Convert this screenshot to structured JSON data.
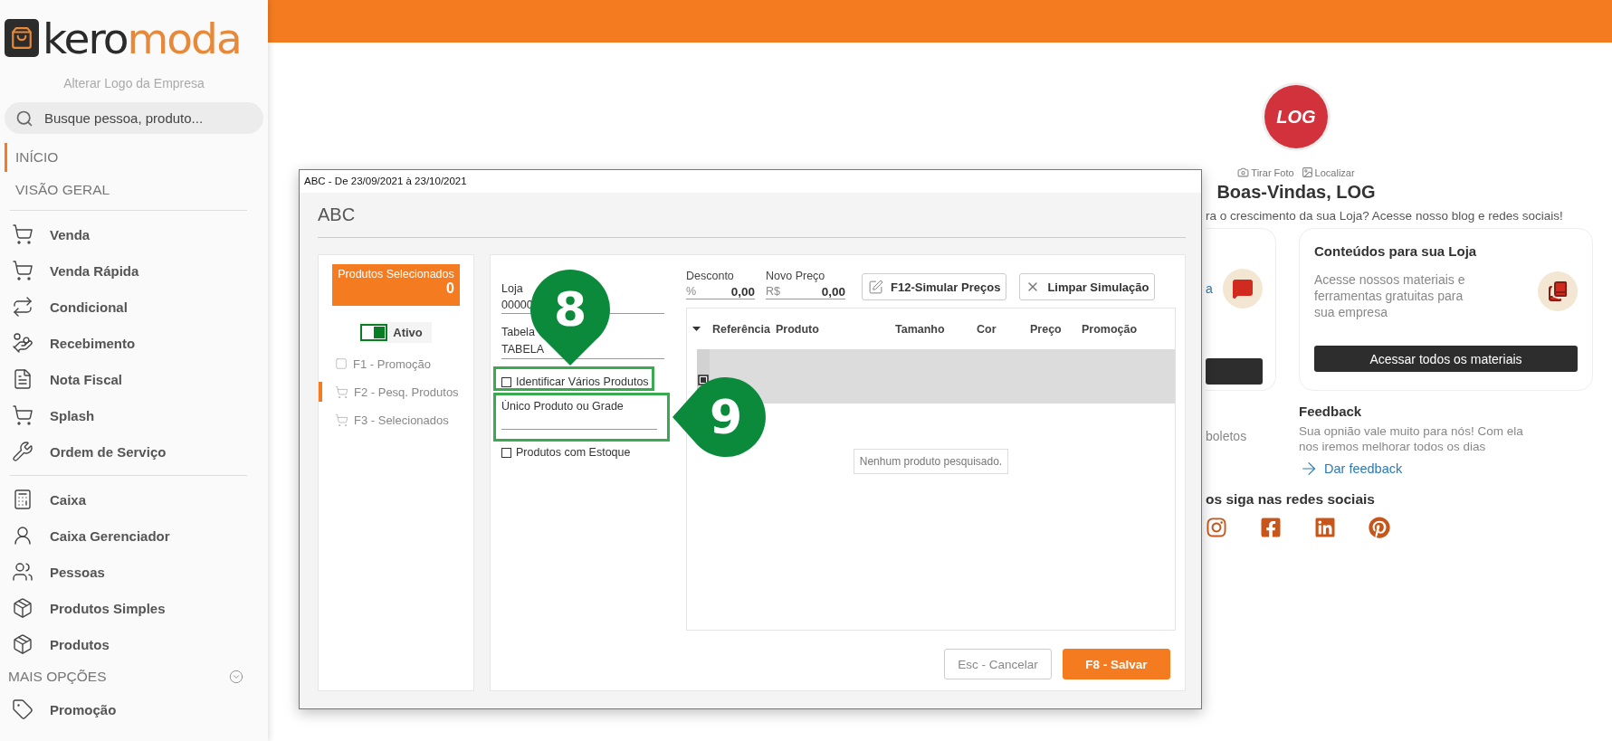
{
  "sidebar": {
    "logo": {
      "wordmark_dark": "kero",
      "wordmark_accent": "moda"
    },
    "change_logo_link": "Alterar Logo da Empresa",
    "search": {
      "placeholder": "Busque pessoa, produto..."
    },
    "nav": [
      {
        "label": "INÍCIO",
        "selected": true
      },
      {
        "label": "VISÃO GERAL",
        "selected": false
      }
    ],
    "groups": [
      [
        {
          "label": "Venda"
        },
        {
          "label": "Venda Rápida"
        },
        {
          "label": "Condicional"
        },
        {
          "label": "Recebimento"
        },
        {
          "label": "Nota Fiscal"
        },
        {
          "label": "Splash"
        },
        {
          "label": "Ordem de Serviço"
        }
      ],
      [
        {
          "label": "Caixa"
        },
        {
          "label": "Caixa Gerenciador"
        },
        {
          "label": "Pessoas"
        },
        {
          "label": "Produtos Simples"
        },
        {
          "label": "Produtos"
        }
      ]
    ],
    "more": {
      "label": "MAIS OPÇÕES",
      "items": [
        {
          "label": "Promoção"
        }
      ]
    }
  },
  "home": {
    "logo_text": "LOG",
    "photo_actions": [
      "Tirar Foto",
      "Localizar"
    ],
    "welcome": "Boas-Vindas, LOG",
    "subtitle": "ra o crescimento da sua Loja? Acesse nosso blog e redes sociais!",
    "left_card": {
      "link": "a"
    },
    "right_card": {
      "title": "Conteúdos para sua Loja",
      "text": "Acesse nossos materiais e ferramentas gratuitas para sua empresa",
      "button": "Acessar todos os materiais"
    },
    "left_fragment": "boletos",
    "feedback": {
      "title": "Feedback",
      "text": "Sua opnião vale muito para nós! Com ela nos iremos melhorar todos os dias",
      "link": "Dar feedback"
    },
    "social": {
      "title": "os siga nas redes sociais"
    }
  },
  "dialog": {
    "window_title": "ABC - De 23/09/2021 à 23/10/2021",
    "heading": "ABC",
    "selected_box": {
      "label": "Produtos Selecionados",
      "count": "0"
    },
    "toggle": {
      "label": "Ativo",
      "on": true
    },
    "nav": [
      {
        "label": "F1 - Promoção",
        "selected": false
      },
      {
        "label": "F2 - Pesq. Produtos",
        "selected": true
      },
      {
        "label": "F3 - Selecionados",
        "selected": false
      }
    ],
    "form": {
      "store": {
        "label": "Loja",
        "value": "00000"
      },
      "table": {
        "label": "Tabela",
        "value": "TABELA"
      },
      "identify_many": {
        "label": "Identificar Vários Produtos",
        "checked": false
      },
      "product_field": {
        "placeholder": "Único Produto ou Grade"
      },
      "with_stock": {
        "label": "Produtos com Estoque",
        "checked": false
      }
    },
    "discount": {
      "label": "Desconto",
      "unit": "%",
      "value": "0,00"
    },
    "new_price": {
      "label": "Novo Preço",
      "unit": "R$",
      "value": "0,00"
    },
    "buttons": [
      "F12-Simular Preços",
      "Limpar Simulação"
    ],
    "grid": {
      "columns": [
        "Referência",
        "Produto",
        "Tamanho",
        "Cor",
        "Preço",
        "Promoção"
      ],
      "empty_message": "Nenhum produto pesquisado."
    },
    "footer": [
      {
        "label": "Esc - Cancelar",
        "kind": "secondary"
      },
      {
        "label": "F8 - Salvar",
        "kind": "primary"
      }
    ],
    "callouts": [
      {
        "label": "8",
        "kind": "down"
      },
      {
        "label": "9",
        "kind": "left"
      }
    ]
  }
}
